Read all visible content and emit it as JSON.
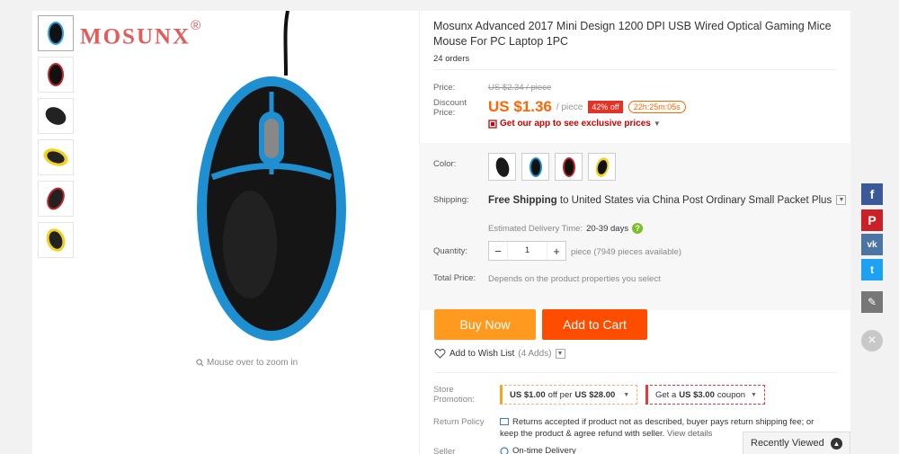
{
  "brand": {
    "logo_text": "MOSUNX",
    "registered": "®"
  },
  "gallery": {
    "thumbnails": [
      "blue",
      "red",
      "black",
      "yellow",
      "red-black",
      "yellow-black"
    ],
    "zoom_hint": "Mouse over to zoom in"
  },
  "product": {
    "title": "Mosunx Advanced 2017 Mini Design 1200 DPI USB Wired Optical Gaming Mice Mouse For PC Laptop 1PC",
    "orders": "24 orders",
    "price_label": "Price:",
    "original_price": "US $2.34 / piece",
    "discount_label": "Discount Price:",
    "discount_price": "US $1.36",
    "per_piece": "/ piece",
    "off_badge": "42% off",
    "timer": "22h:25m:05s",
    "app_promo": "Get our app to see exclusive prices"
  },
  "options": {
    "color_label": "Color:",
    "colors": [
      "black",
      "blue",
      "red",
      "yellow"
    ],
    "shipping_label": "Shipping:",
    "shipping_text_bold": "Free Shipping",
    "shipping_text_rest": "to United States via China Post Ordinary Small Packet Plus",
    "eta_label": "Estimated Delivery Time:",
    "eta_days": "20-39 days",
    "quantity_label": "Quantity:",
    "quantity_value": "1",
    "availability": "piece (7949 pieces available)",
    "total_label": "Total Price:",
    "total_desc": "Depends on the product properties you select"
  },
  "actions": {
    "buy_now": "Buy Now",
    "add_to_cart": "Add to Cart",
    "wishlist": "Add to Wish List",
    "wishlist_count": "(4 Adds)"
  },
  "store": {
    "promo_label": "Store Promotion:",
    "coupon1_pre": "US $1.00",
    "coupon1_mid": "off per",
    "coupon1_post": "US $28.00",
    "coupon2_pre": "Get a",
    "coupon2_amount": "US $3.00",
    "coupon2_post": "coupon",
    "return_label": "Return Policy",
    "return_text": "Returns accepted if product not as described, buyer pays return shipping fee; or keep the product & agree refund with seller.",
    "return_view": "View details",
    "seller_label": "Seller",
    "ontime": "On-time Delivery"
  },
  "recently_viewed": "Recently Viewed",
  "social": [
    "facebook",
    "pinterest",
    "vk",
    "twitter",
    "edit"
  ],
  "colors": {
    "accent_orange": "#ff4d00",
    "buy_orange": "#ff9a1e",
    "price_orange": "#ff6600",
    "badge_red": "#e43225"
  }
}
